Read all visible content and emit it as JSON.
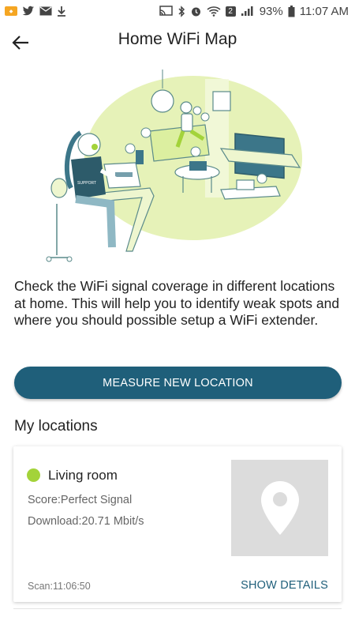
{
  "status_bar": {
    "signal_badge": "2",
    "battery_percent": "93%",
    "time": "11:07 AM",
    "icons": [
      "notification-app-icon",
      "twitter-icon",
      "mail-icon",
      "download-icon",
      "cast-icon",
      "bluetooth-icon",
      "alarm-icon",
      "wifi-icon",
      "signal-icon",
      "battery-icon"
    ]
  },
  "app_bar": {
    "title": "Home WiFi Map",
    "back_icon": "arrow-left-icon"
  },
  "description": "Check the WiFi signal coverage in different locations at home. This will help you to identify weak spots and where you should possible setup a WiFi extender.",
  "measure_button": {
    "label": "MEASURE NEW LOCATION"
  },
  "locations": {
    "title": "My locations",
    "items": [
      {
        "name": "Living room",
        "score": "Score:Perfect Signal",
        "download": "Download:20.71 Mbit/s",
        "scan": "Scan:11:06:50",
        "details_label": "SHOW DETAILS",
        "status_color": "#a3d33a"
      }
    ]
  },
  "illustration": {
    "support_label": "SUPPORT"
  },
  "colors": {
    "primary": "#1f5f7a",
    "accent_green": "#a3d33a",
    "illustration_fill": "#e6f2b8"
  }
}
